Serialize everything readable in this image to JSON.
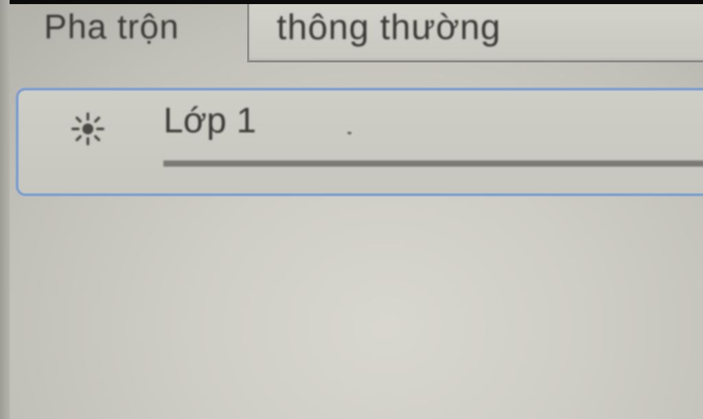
{
  "blend": {
    "label": "Pha trộn",
    "value": "thông thường"
  },
  "layer": {
    "name": "Lớp 1",
    "icon": "sun-icon"
  }
}
